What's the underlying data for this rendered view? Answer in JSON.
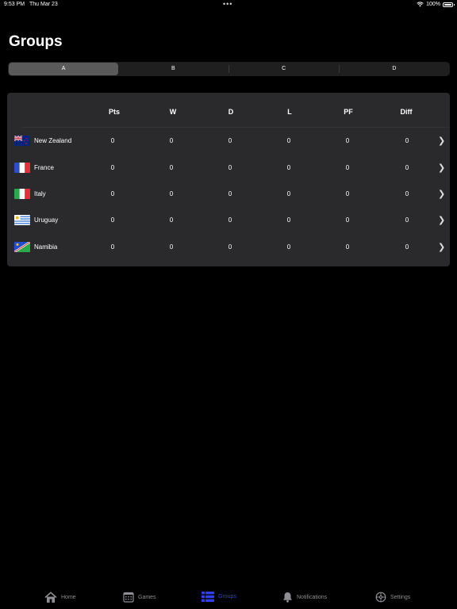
{
  "status": {
    "time": "9:53 PM",
    "date": "Thu Mar 23",
    "dots": "•••",
    "battery": "100%"
  },
  "page": {
    "title": "Groups"
  },
  "segments": [
    "A",
    "B",
    "C",
    "D"
  ],
  "selected_segment": "A",
  "table": {
    "columns": [
      "Pts",
      "W",
      "D",
      "L",
      "PF",
      "Diff"
    ],
    "rows": [
      {
        "team": "New Zealand",
        "flag": "new-zealand-flag-icon",
        "values": [
          "0",
          "0",
          "0",
          "0",
          "0",
          "0"
        ]
      },
      {
        "team": "France",
        "flag": "france-flag-icon",
        "values": [
          "0",
          "0",
          "0",
          "0",
          "0",
          "0"
        ]
      },
      {
        "team": "Italy",
        "flag": "italy-flag-icon",
        "values": [
          "0",
          "0",
          "0",
          "0",
          "0",
          "0"
        ]
      },
      {
        "team": "Uruguay",
        "flag": "uruguay-flag-icon",
        "values": [
          "0",
          "0",
          "0",
          "0",
          "0",
          "0"
        ]
      },
      {
        "team": "Namibia",
        "flag": "namibia-flag-icon",
        "values": [
          "0",
          "0",
          "0",
          "0",
          "0",
          "0"
        ]
      }
    ]
  },
  "tabs": [
    {
      "label": "Home",
      "icon": "house-icon"
    },
    {
      "label": "Games",
      "icon": "calendar-icon"
    },
    {
      "label": "Groups",
      "icon": "list-icon",
      "active": true
    },
    {
      "label": "Notifications",
      "icon": "bell-icon"
    },
    {
      "label": "Settings",
      "icon": "gear-icon"
    }
  ],
  "colors": {
    "background": "#000000",
    "card": "#2a2a2c",
    "segment_selected": "#5a5a5a",
    "tab_active": "#2f3ef5",
    "tab_inactive": "#8e8e93"
  }
}
